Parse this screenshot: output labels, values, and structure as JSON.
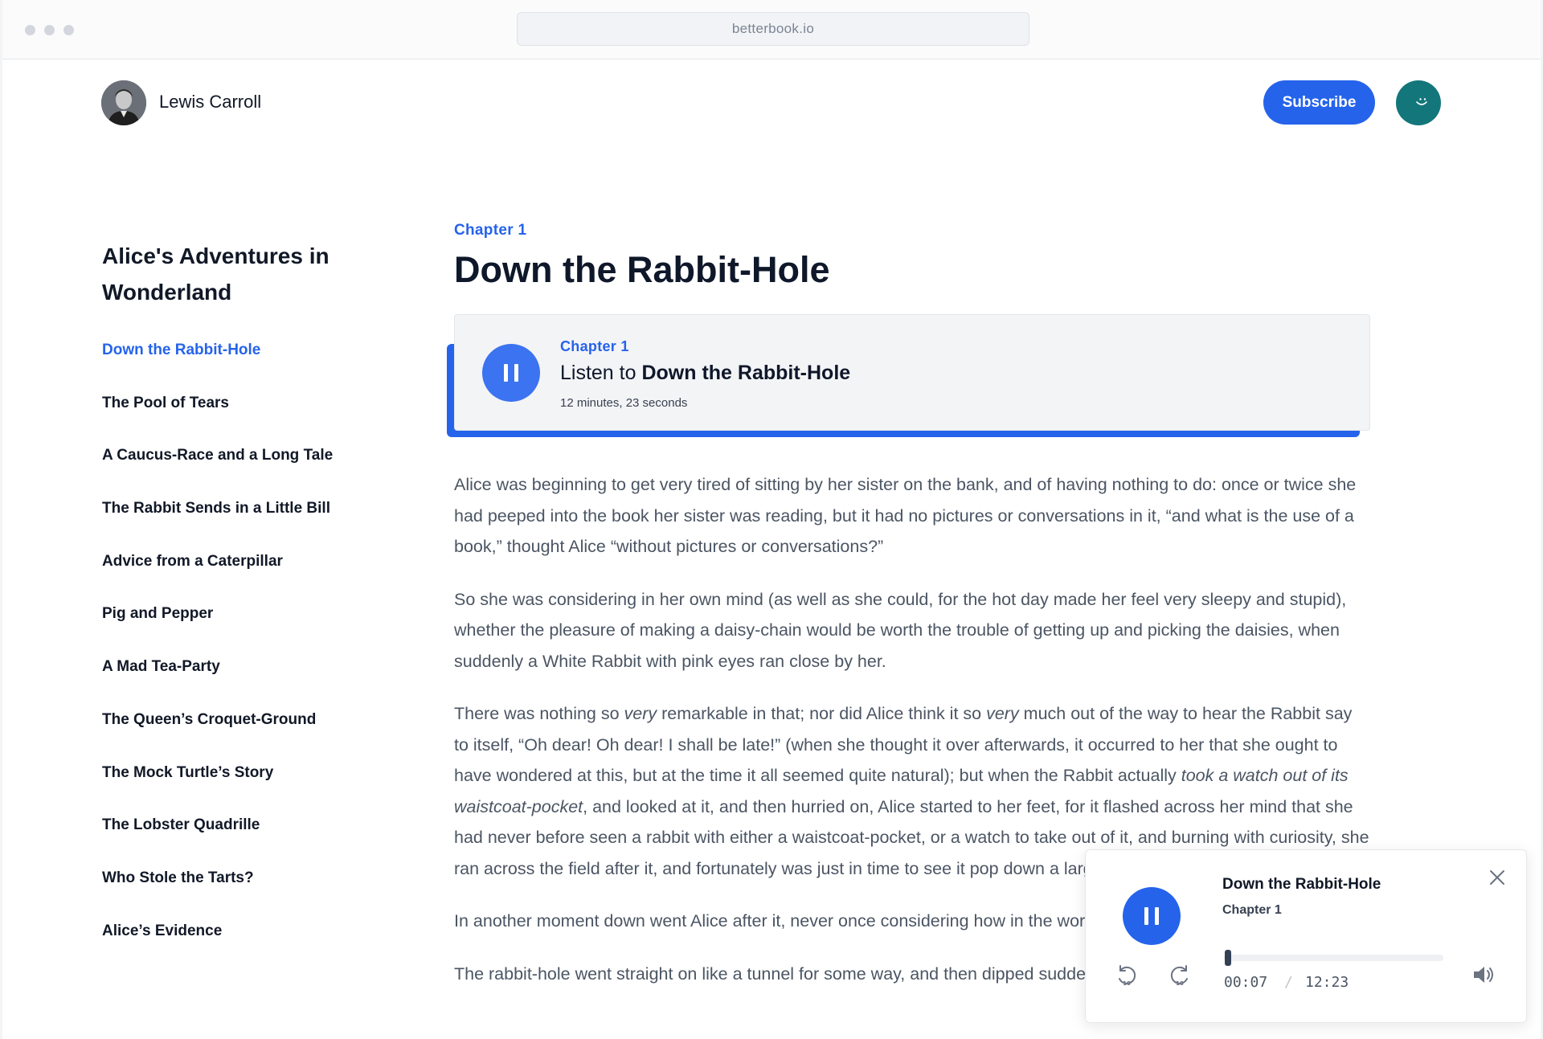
{
  "browser": {
    "url": "betterbook.io"
  },
  "header": {
    "author_name": "Lewis Carroll",
    "subscribe_label": "Subscribe"
  },
  "sidebar": {
    "book_title": "Alice's Adventures in Wonderland",
    "chapters": [
      {
        "label": "Down the Rabbit-Hole",
        "active": true
      },
      {
        "label": "The Pool of Tears",
        "active": false
      },
      {
        "label": "A Caucus-Race and a Long Tale",
        "active": false
      },
      {
        "label": "The Rabbit Sends in a Little Bill",
        "active": false
      },
      {
        "label": "Advice from a Caterpillar",
        "active": false
      },
      {
        "label": "Pig and Pepper",
        "active": false
      },
      {
        "label": "A Mad Tea-Party",
        "active": false
      },
      {
        "label": "The Queen’s Croquet-Ground",
        "active": false
      },
      {
        "label": "The Mock Turtle’s Story",
        "active": false
      },
      {
        "label": "The Lobster Quadrille",
        "active": false
      },
      {
        "label": "Who Stole the Tarts?",
        "active": false
      },
      {
        "label": "Alice’s Evidence",
        "active": false
      }
    ]
  },
  "main": {
    "chapter_kicker": "Chapter 1",
    "chapter_title": "Down the Rabbit-Hole",
    "audio_card": {
      "kicker": "Chapter 1",
      "listen_prefix": "Listen to",
      "listen_title": "Down the Rabbit-Hole",
      "duration": "12 minutes, 23 seconds",
      "state": "playing"
    },
    "paragraphs": [
      [
        {
          "text": "Alice was beginning to get very tired of sitting by her sister on the bank, and of having nothing to do: once or twice she had peeped into the book her sister was reading, but it had no pictures or conversations in it, “and what is the use of a book,” thought Alice “without pictures or conversations?”"
        }
      ],
      [
        {
          "text": "So she was considering in her own mind (as well as she could, for the hot day made her feel very sleepy and stupid), whether the pleasure of making a daisy-chain would be worth the trouble of getting up and picking the daisies, when suddenly a White Rabbit with pink eyes ran close by her."
        }
      ],
      [
        {
          "text": "There was nothing so "
        },
        {
          "text": "very",
          "italic": true
        },
        {
          "text": " remarkable in that; nor did Alice think it so "
        },
        {
          "text": "very",
          "italic": true
        },
        {
          "text": " much out of the way to hear the Rabbit say to itself, “Oh dear! Oh dear! I shall be late!” (when she thought it over afterwards, it occurred to her that she ought to have wondered at this, but at the time it all seemed quite natural); but when the Rabbit actually "
        },
        {
          "text": "took a watch out of its waistcoat-pocket",
          "italic": true
        },
        {
          "text": ", and looked at it, and then hurried on, Alice started to her feet, for it flashed across her mind that she had never before seen a rabbit with either a waistcoat-pocket, or a watch to take out of it, and burning with curiosity, she ran across the field after it, and fortunately was just in time to see it pop down a large rabbit-hole under the hedge."
        }
      ],
      [
        {
          "text": "In another moment down went Alice after it, never once considering how in the world she was to get out again."
        }
      ],
      [
        {
          "text": "The rabbit-hole went straight on like a tunnel for some way, and then dipped suddenly down, so suddenly"
        }
      ]
    ]
  },
  "player": {
    "title": "Down the Rabbit-Hole",
    "chapter": "Chapter 1",
    "current_time": "00:07",
    "separator": "/",
    "total_time": "12:23",
    "progress_fraction": 0.0094,
    "state": "playing"
  },
  "icons": {
    "card_play": "pause-icon",
    "player_play": "pause-icon",
    "close": "close-icon",
    "rewind": "rewind-10-icon",
    "forward": "forward-10-icon",
    "volume": "volume-icon"
  },
  "colors": {
    "accent": "#2563eb",
    "user_avatar": "#13767a"
  }
}
